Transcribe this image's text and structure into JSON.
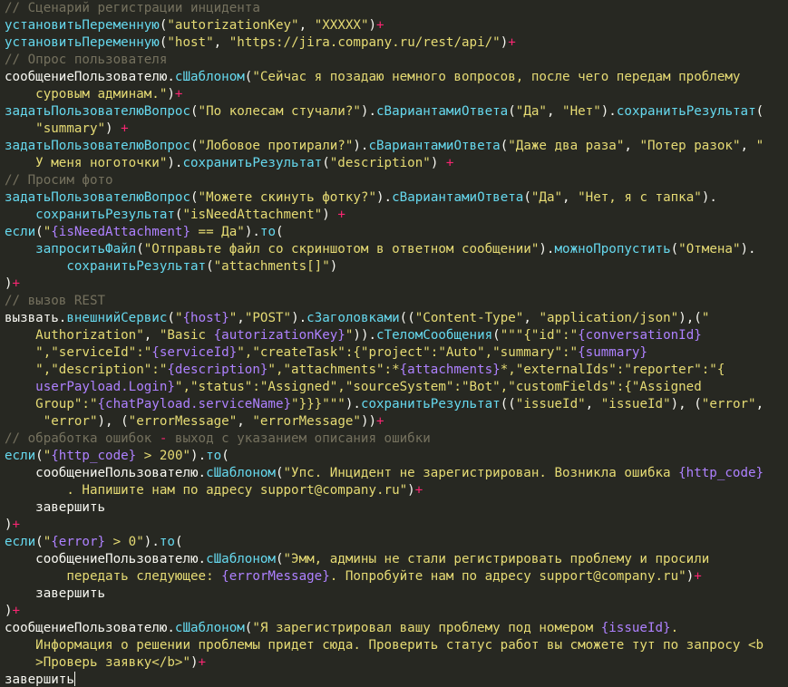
{
  "theme": {
    "background": "#272822",
    "plain": "#f8f8f2",
    "comment": "#75715e",
    "function": "#66d9ef",
    "string": "#e6db74",
    "operator": "#f92672",
    "variable": "#ae81ff"
  },
  "cursor": {
    "line": 39
  },
  "lines": [
    [
      [
        "c",
        "// Сценарий регистрации инцидента"
      ]
    ],
    [
      [
        "f",
        "установитьПеременную"
      ],
      [
        "p",
        "("
      ],
      [
        "s",
        "\"autorizationKey\""
      ],
      [
        "p",
        ", "
      ],
      [
        "s",
        "\"XXXXX\""
      ],
      [
        "p",
        ")"
      ],
      [
        "o",
        "+"
      ]
    ],
    [
      [
        "f",
        "установитьПеременную"
      ],
      [
        "p",
        "("
      ],
      [
        "s",
        "\"host\""
      ],
      [
        "p",
        ", "
      ],
      [
        "s",
        "\"https://jira.company.ru/rest/api/\""
      ],
      [
        "p",
        ")"
      ],
      [
        "o",
        "+"
      ]
    ],
    [
      [
        "c",
        "// Опрос пользователя"
      ]
    ],
    [
      [
        "p",
        "сообщениеПользователю."
      ],
      [
        "f",
        "сШаблоном"
      ],
      [
        "p",
        "("
      ],
      [
        "s",
        "\"Сейчас я позадаю немного вопросов, после чего передам проблему"
      ]
    ],
    [
      [
        "s",
        "    суровым админам.\""
      ],
      [
        "p",
        ")"
      ],
      [
        "o",
        "+"
      ]
    ],
    [
      [
        "f",
        "задатьПользователюВопрос"
      ],
      [
        "p",
        "("
      ],
      [
        "s",
        "\"По колесам стучали?\""
      ],
      [
        "p",
        ")."
      ],
      [
        "f",
        "сВариантамиОтвета"
      ],
      [
        "p",
        "("
      ],
      [
        "s",
        "\"Да\""
      ],
      [
        "p",
        ", "
      ],
      [
        "s",
        "\"Нет\""
      ],
      [
        "p",
        ")."
      ],
      [
        "f",
        "сохранитьРезультат"
      ],
      [
        "p",
        "("
      ]
    ],
    [
      [
        "s",
        "    \"summary\""
      ],
      [
        "p",
        ") "
      ],
      [
        "o",
        "+"
      ]
    ],
    [
      [
        "f",
        "задатьПользователюВопрос"
      ],
      [
        "p",
        "("
      ],
      [
        "s",
        "\"Лобовое протирали?\""
      ],
      [
        "p",
        ")."
      ],
      [
        "f",
        "сВариантамиОтвета"
      ],
      [
        "p",
        "("
      ],
      [
        "s",
        "\"Даже два раза\""
      ],
      [
        "p",
        ", "
      ],
      [
        "s",
        "\"Потер разок\""
      ],
      [
        "p",
        ", "
      ],
      [
        "s",
        "\""
      ]
    ],
    [
      [
        "s",
        "    У меня ноготочки\""
      ],
      [
        "p",
        ")."
      ],
      [
        "f",
        "сохранитьРезультат"
      ],
      [
        "p",
        "("
      ],
      [
        "s",
        "\"description\""
      ],
      [
        "p",
        ") "
      ],
      [
        "o",
        "+"
      ]
    ],
    [
      [
        "c",
        "// Просим фото"
      ]
    ],
    [
      [
        "f",
        "задатьПользователюВопрос"
      ],
      [
        "p",
        "("
      ],
      [
        "s",
        "\"Можете скинуть фотку?\""
      ],
      [
        "p",
        ")."
      ],
      [
        "f",
        "сВариантамиОтвета"
      ],
      [
        "p",
        "("
      ],
      [
        "s",
        "\"Да\""
      ],
      [
        "p",
        ", "
      ],
      [
        "s",
        "\"Нет, я с тапка\""
      ],
      [
        "p",
        ")."
      ]
    ],
    [
      [
        "f",
        "    сохранитьРезультат"
      ],
      [
        "p",
        "("
      ],
      [
        "s",
        "\"isNeedAttachment\""
      ],
      [
        "p",
        ") "
      ],
      [
        "o",
        "+"
      ]
    ],
    [
      [
        "f",
        "если"
      ],
      [
        "p",
        "("
      ],
      [
        "s",
        "\""
      ],
      [
        "v",
        "{isNeedAttachment}"
      ],
      [
        "s",
        " == Да\""
      ],
      [
        "p",
        ")."
      ],
      [
        "f",
        "то"
      ],
      [
        "p",
        "("
      ]
    ],
    [
      [
        "f",
        "    запроситьФайл"
      ],
      [
        "p",
        "("
      ],
      [
        "s",
        "\"Отправьте файл со скриншотом в ответном сообщении\""
      ],
      [
        "p",
        ")."
      ],
      [
        "f",
        "можноПропустить"
      ],
      [
        "p",
        "("
      ],
      [
        "s",
        "\"Отмена\""
      ],
      [
        "p",
        ")."
      ]
    ],
    [
      [
        "f",
        "        сохранитьРезультат"
      ],
      [
        "p",
        "("
      ],
      [
        "s",
        "\"attachments[]\""
      ],
      [
        "p",
        ")"
      ]
    ],
    [
      [
        "p",
        ")"
      ],
      [
        "o",
        "+"
      ]
    ],
    [
      [
        "c",
        "// вызов REST"
      ]
    ],
    [
      [
        "p",
        "вызвать."
      ],
      [
        "f",
        "внешнийСервис"
      ],
      [
        "p",
        "("
      ],
      [
        "s",
        "\""
      ],
      [
        "v",
        "{host}"
      ],
      [
        "s",
        "\""
      ],
      [
        "p",
        ","
      ],
      [
        "s",
        "\"POST\""
      ],
      [
        "p",
        ")."
      ],
      [
        "f",
        "сЗаголовками"
      ],
      [
        "p",
        "(("
      ],
      [
        "s",
        "\"Content-Type\""
      ],
      [
        "p",
        ", "
      ],
      [
        "s",
        "\"application/json\""
      ],
      [
        "p",
        "),("
      ],
      [
        "s",
        "\""
      ]
    ],
    [
      [
        "s",
        "    Authorization\""
      ],
      [
        "p",
        ", "
      ],
      [
        "s",
        "\"Basic "
      ],
      [
        "v",
        "{autorizationKey}"
      ],
      [
        "s",
        "\""
      ],
      [
        "p",
        "))."
      ],
      [
        "f",
        "сТеломСообщения"
      ],
      [
        "p",
        "("
      ],
      [
        "s",
        "\"\"\"{\"id\":\""
      ],
      [
        "v",
        "{conversationId}"
      ]
    ],
    [
      [
        "s",
        "    \",\"serviceId\":\""
      ],
      [
        "v",
        "{serviceId}"
      ],
      [
        "s",
        "\",\"createTask\":{\"project\":\"Auto\",\"summary\":\""
      ],
      [
        "v",
        "{summary}"
      ]
    ],
    [
      [
        "s",
        "    \",\"description\":\""
      ],
      [
        "v",
        "{description}"
      ],
      [
        "s",
        "\",\"attachments\":*"
      ],
      [
        "v",
        "{attachments}"
      ],
      [
        "s",
        "*,\"externalIds\":\"reporter\":\"{"
      ]
    ],
    [
      [
        "v",
        "    userPayload.Login}"
      ],
      [
        "s",
        "\",\"status\":\"Assigned\",\"sourceSystem\":\"Bot\",\"customFields\":{\"Assigned"
      ]
    ],
    [
      [
        "s",
        "    Group\":\""
      ],
      [
        "v",
        "{chatPayload.serviceName}"
      ],
      [
        "s",
        "\"}}}\"\"\""
      ],
      [
        "p",
        ")."
      ],
      [
        "f",
        "сохранитьРезультат"
      ],
      [
        "p",
        "(("
      ],
      [
        "s",
        "\"issueId\""
      ],
      [
        "p",
        ", "
      ],
      [
        "s",
        "\"issueId\""
      ],
      [
        "p",
        "), ("
      ],
      [
        "s",
        "\"error\""
      ],
      [
        "p",
        ","
      ]
    ],
    [
      [
        "s",
        "     \"error\""
      ],
      [
        "p",
        "), ("
      ],
      [
        "s",
        "\"errorMessage\""
      ],
      [
        "p",
        ", "
      ],
      [
        "s",
        "\"errorMessage\""
      ],
      [
        "p",
        "))"
      ],
      [
        "o",
        "+"
      ]
    ],
    [
      [
        "c",
        "// обработка ошибок "
      ],
      [
        "o",
        "-"
      ],
      [
        "c",
        " выход с указанием описания ошибки"
      ]
    ],
    [
      [
        "f",
        "если"
      ],
      [
        "p",
        "("
      ],
      [
        "s",
        "\""
      ],
      [
        "v",
        "{http_code}"
      ],
      [
        "s",
        " > 200\""
      ],
      [
        "p",
        ")."
      ],
      [
        "f",
        "то"
      ],
      [
        "p",
        "("
      ]
    ],
    [
      [
        "p",
        "    сообщениеПользователю."
      ],
      [
        "f",
        "сШаблоном"
      ],
      [
        "p",
        "("
      ],
      [
        "s",
        "\"Упс. Инцидент не зарегистрирован. Возникла ошибка "
      ],
      [
        "v",
        "{http_code}"
      ]
    ],
    [
      [
        "s",
        "        . Напишите нам по адресу support@company.ru\""
      ],
      [
        "p",
        ")"
      ],
      [
        "o",
        "+"
      ]
    ],
    [
      [
        "p",
        "    завершить"
      ]
    ],
    [
      [
        "p",
        ")"
      ],
      [
        "o",
        "+"
      ]
    ],
    [
      [
        "f",
        "если"
      ],
      [
        "p",
        "("
      ],
      [
        "s",
        "\""
      ],
      [
        "v",
        "{error}"
      ],
      [
        "s",
        " > 0\""
      ],
      [
        "p",
        ")."
      ],
      [
        "f",
        "то"
      ],
      [
        "p",
        "("
      ]
    ],
    [
      [
        "p",
        "    сообщениеПользователю."
      ],
      [
        "f",
        "сШаблоном"
      ],
      [
        "p",
        "("
      ],
      [
        "s",
        "\"Эмм, админы не стали регистрировать проблему и просили"
      ]
    ],
    [
      [
        "s",
        "        передать следующее: "
      ],
      [
        "v",
        "{errorMessage}"
      ],
      [
        "s",
        ". Попробуйте нам по адресу support@company.ru\""
      ],
      [
        "p",
        ")"
      ],
      [
        "o",
        "+"
      ]
    ],
    [
      [
        "p",
        "    завершить"
      ]
    ],
    [
      [
        "p",
        ")"
      ],
      [
        "o",
        "+"
      ]
    ],
    [
      [
        "p",
        "сообщениеПользователю."
      ],
      [
        "f",
        "сШаблоном"
      ],
      [
        "p",
        "("
      ],
      [
        "s",
        "\"Я зарегистрировал вашу проблему под номером "
      ],
      [
        "v",
        "{issueId}"
      ],
      [
        "s",
        "."
      ]
    ],
    [
      [
        "s",
        "    Информация о решении проблемы придет сюда. Проверить статус работ вы сможете тут по запросу <b"
      ]
    ],
    [
      [
        "s",
        "    >Проверь заявку</b>\""
      ],
      [
        "p",
        ")"
      ],
      [
        "o",
        "+"
      ]
    ],
    [
      [
        "p",
        "завершить"
      ]
    ]
  ]
}
